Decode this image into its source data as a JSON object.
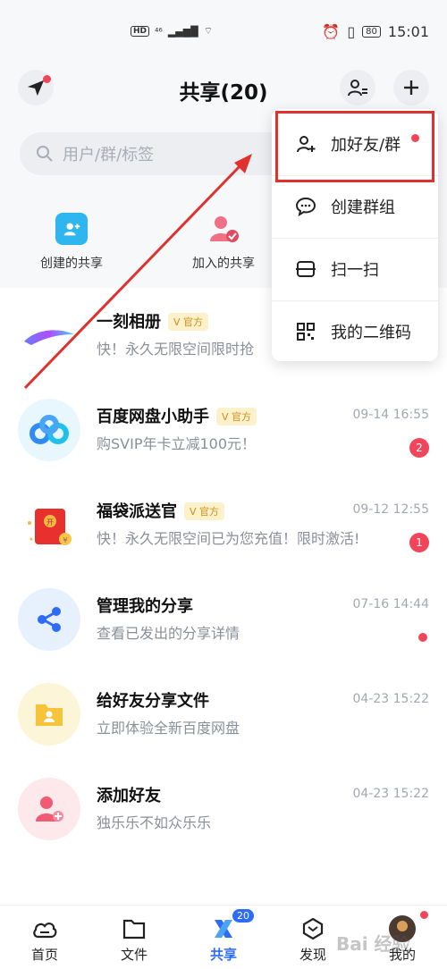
{
  "status_bar": {
    "left_indicators": [
      "HD",
      "⁴⁶",
      "▂▄▆█",
      "⌔"
    ],
    "right_indicators": [
      "⏰",
      "▯",
      "80"
    ],
    "time": "15:01"
  },
  "header": {
    "title": "共享(20)"
  },
  "search": {
    "placeholder": "用户/群/标签"
  },
  "quick_actions": [
    {
      "label": "创建的共享",
      "icon": "share-create-icon"
    },
    {
      "label": "加入的共享",
      "icon": "share-join-icon"
    }
  ],
  "conversations": [
    {
      "title": "一刻相册",
      "official": "V 官方",
      "subtitle": "快！永久无限空间限时抢",
      "time": "",
      "count": "",
      "dot": false
    },
    {
      "title": "百度网盘小助手",
      "official": "V 官方",
      "subtitle": "购SVIP年卡立减100元！",
      "time": "09-14 16:55",
      "count": "2",
      "dot": false
    },
    {
      "title": "福袋派送官",
      "official": "V 官方",
      "subtitle": "快！永久无限空间已为您充值！限时激活!",
      "time": "09-12 12:55",
      "count": "1",
      "dot": false
    },
    {
      "title": "管理我的分享",
      "official": "",
      "subtitle": "查看已发出的分享详情",
      "time": "07-16 14:44",
      "count": "",
      "dot": true
    },
    {
      "title": "给好友分享文件",
      "official": "",
      "subtitle": "立即体验全新百度网盘",
      "time": "04-23 15:22",
      "count": "",
      "dot": false
    },
    {
      "title": "添加好友",
      "official": "",
      "subtitle": "独乐乐不如众乐乐",
      "time": "04-23 15:22",
      "count": "",
      "dot": false
    }
  ],
  "dropdown_menu": [
    {
      "label": "加好友/群",
      "icon": "add-friend-icon"
    },
    {
      "label": "创建群组",
      "icon": "chat-bubble-icon"
    },
    {
      "label": "扫一扫",
      "icon": "scan-icon"
    },
    {
      "label": "我的二维码",
      "icon": "qr-code-icon"
    }
  ],
  "tab_bar": {
    "tabs": [
      {
        "label": "首页",
        "icon": "cloud-icon"
      },
      {
        "label": "文件",
        "icon": "folder-icon"
      },
      {
        "label": "共享",
        "icon": "share-icon",
        "active": true
      },
      {
        "label": "发现",
        "icon": "discover-icon"
      },
      {
        "label": "我的",
        "icon": "avatar-icon"
      }
    ],
    "share_badge": "20"
  },
  "watermark": "Bai 经验",
  "colors": {
    "accent": "#2c6cf6",
    "badge_red": "#f0455b",
    "highlight_red": "#e0312f"
  }
}
